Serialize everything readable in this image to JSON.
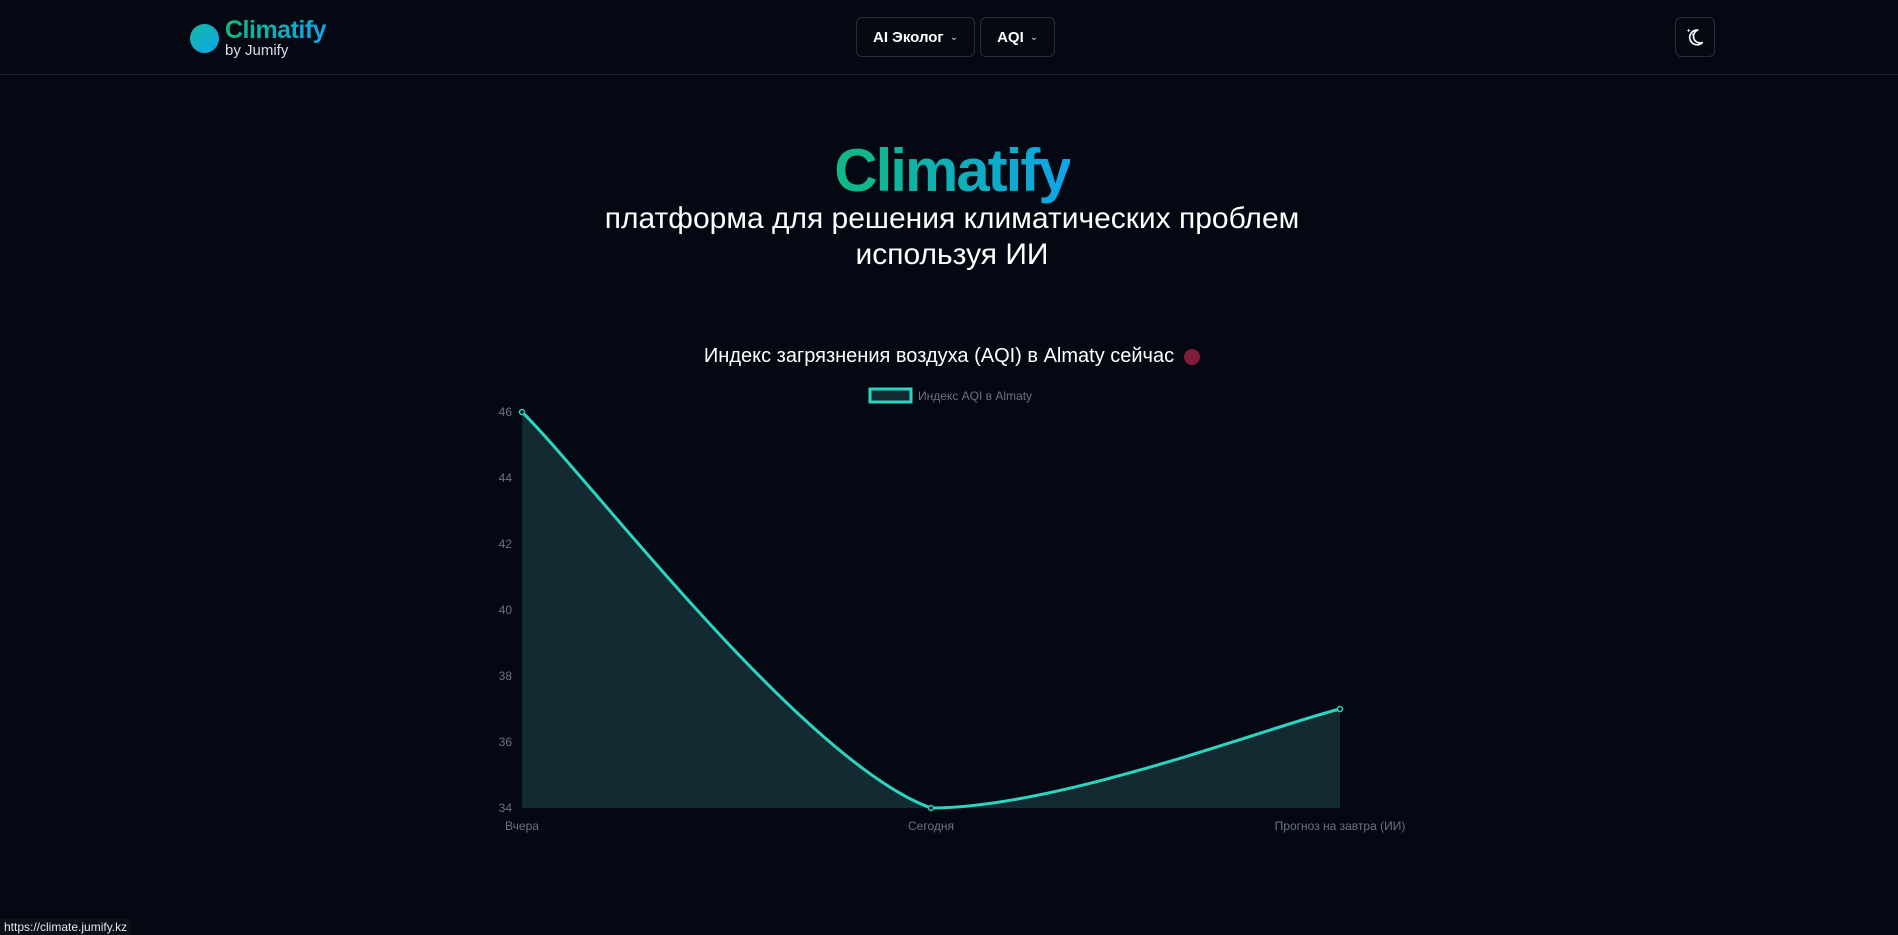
{
  "brand": {
    "name": "Climatify",
    "byline": "by Jumify"
  },
  "nav": {
    "items": [
      {
        "label": "AI Эколог"
      },
      {
        "label": "AQI"
      }
    ],
    "theme_toggle_icon": "moon-stars-icon"
  },
  "hero": {
    "title": "Climatify",
    "subtitle_line1": "платформа для решения климатических проблем",
    "subtitle_line2": "используя ИИ"
  },
  "aqi_section": {
    "heading": "Индекс загрязнения воздуха (AQI) в Almaty сейчас",
    "status_color": "#7f1d3b"
  },
  "chart_data": {
    "type": "area",
    "categories": [
      "Вчера",
      "Сегодня",
      "Прогноз на завтра (ИИ)"
    ],
    "series": [
      {
        "name": "Индекс AQI в Almaty",
        "values": [
          46,
          34,
          37
        ],
        "color": "#2dd4bf",
        "fill": "#132a33"
      }
    ],
    "yticks": [
      34,
      36,
      38,
      40,
      42,
      44,
      46
    ],
    "ylim": [
      34,
      46
    ],
    "legend": "top-center",
    "grid": false
  },
  "status_bar": {
    "url": "https://climate.jumify.kz"
  },
  "colors": {
    "background": "#040812",
    "accent_start": "#10b981",
    "accent_end": "#0ea5e9",
    "line": "#2dd4bf"
  }
}
